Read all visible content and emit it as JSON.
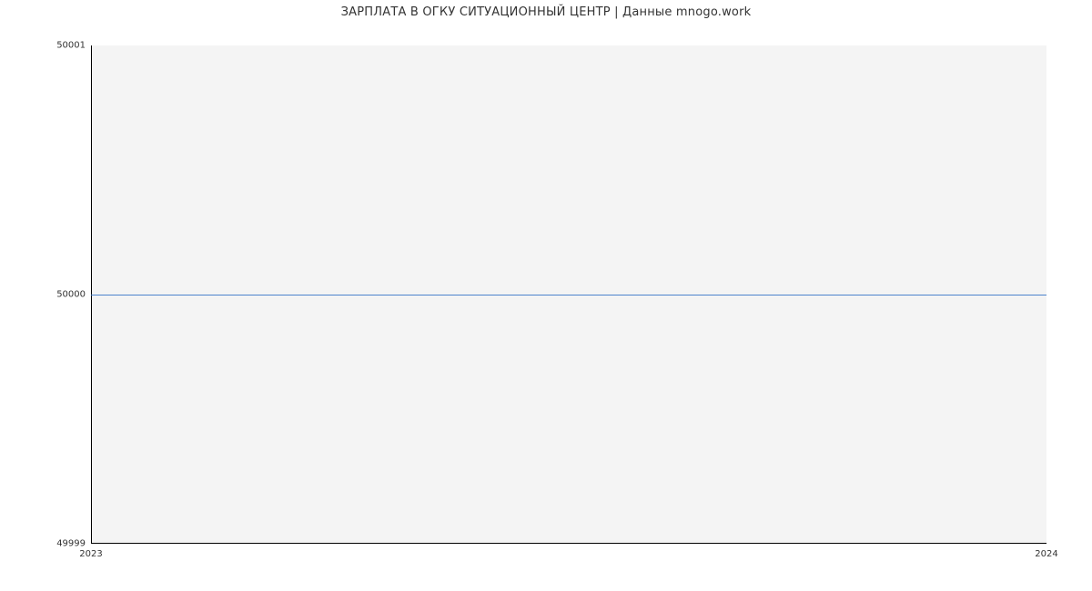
{
  "chart_data": {
    "type": "line",
    "title": "ЗАРПЛАТА В ОГКУ СИТУАЦИОННЫЙ ЦЕНТР | Данные mnogo.work",
    "xlabel": "",
    "ylabel": "",
    "x": [
      "2023",
      "2024"
    ],
    "values": [
      50000,
      50000
    ],
    "ylim": [
      49999,
      50001
    ],
    "y_ticks": [
      49999,
      50000,
      50001
    ],
    "x_ticks": [
      "2023",
      "2024"
    ],
    "line_color": "#3a78c8",
    "plot_bg": "#f4f4f4"
  }
}
